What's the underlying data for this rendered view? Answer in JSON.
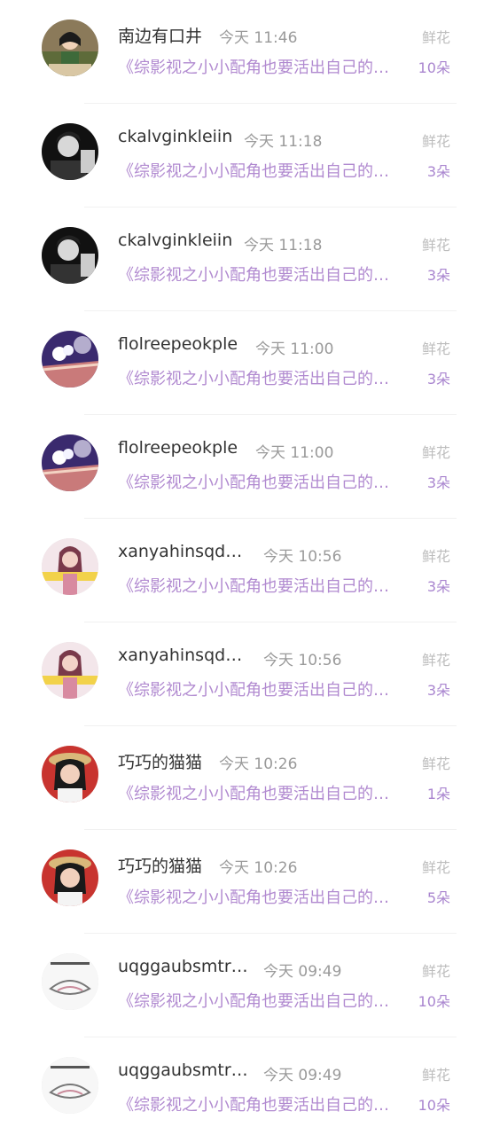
{
  "gift_list": {
    "items": [
      {
        "user": "南边有口井",
        "time": "今天 11:46",
        "gift": "鲜花",
        "novel": "《综影视之小小配角也要活出自己的…",
        "count": "10朵",
        "avatar_icon": "girl-avatar-icon"
      },
      {
        "user": "ckalvginkleiin",
        "time": "今天 11:18",
        "gift": "鲜花",
        "novel": "《综影视之小小配角也要活出自己的…",
        "count": "3朵",
        "avatar_icon": "man-avatar-icon"
      },
      {
        "user": "ckalvginkleiin",
        "time": "今天 11:18",
        "gift": "鲜花",
        "novel": "《综影视之小小配角也要活出自己的…",
        "count": "3朵",
        "avatar_icon": "man-avatar-icon"
      },
      {
        "user": "flolreepeokple",
        "time": "今天 11:00",
        "gift": "鲜花",
        "novel": "《综影视之小小配角也要活出自己的…",
        "count": "3朵",
        "avatar_icon": "book-avatar-icon"
      },
      {
        "user": "flolreepeokple",
        "time": "今天 11:00",
        "gift": "鲜花",
        "novel": "《综影视之小小配角也要活出自己的…",
        "count": "3朵",
        "avatar_icon": "book-avatar-icon"
      },
      {
        "user": "xanyahinsqde…",
        "time": "今天 10:56",
        "gift": "鲜花",
        "novel": "《综影视之小小配角也要活出自己的…",
        "count": "3朵",
        "avatar_icon": "girl-avatar-icon"
      },
      {
        "user": "xanyahinsqde…",
        "time": "今天 10:56",
        "gift": "鲜花",
        "novel": "《综影视之小小配角也要活出自己的…",
        "count": "3朵",
        "avatar_icon": "girl-avatar-icon"
      },
      {
        "user": "巧巧的猫猫",
        "time": "今天 10:26",
        "gift": "鲜花",
        "novel": "《综影视之小小配角也要活出自己的…",
        "count": "1朵",
        "avatar_icon": "hat-girl-avatar-icon"
      },
      {
        "user": "巧巧的猫猫",
        "time": "今天 10:26",
        "gift": "鲜花",
        "novel": "《综影视之小小配角也要活出自己的…",
        "count": "5朵",
        "avatar_icon": "hat-girl-avatar-icon"
      },
      {
        "user": "uqggaubsmtr…",
        "time": "今天 09:49",
        "gift": "鲜花",
        "novel": "《综影视之小小配角也要活出自己的…",
        "count": "10朵",
        "avatar_icon": "sketch-avatar-icon"
      },
      {
        "user": "uqggaubsmtr…",
        "time": "今天 09:49",
        "gift": "鲜花",
        "novel": "《综影视之小小配角也要活出自己的…",
        "count": "10朵",
        "avatar_icon": "sketch-avatar-icon"
      }
    ]
  }
}
